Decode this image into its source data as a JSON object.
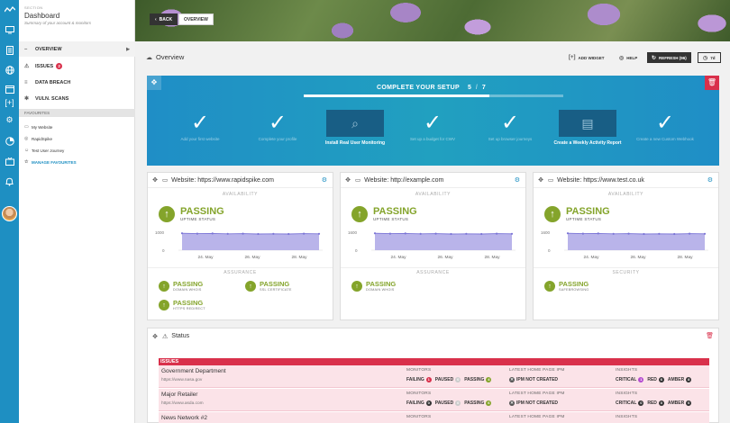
{
  "sidebar": {
    "section_label": "SECTION",
    "title": "Dashboard",
    "subtitle": "Summary of your account & monitors",
    "nav": [
      {
        "label": "OVERVIEW"
      },
      {
        "label": "ISSUES",
        "badge": "2"
      },
      {
        "label": "DATA BREACH"
      },
      {
        "label": "VULN. SCANS"
      }
    ],
    "favourites_label": "FAVOURITES",
    "favourites": [
      "My Website",
      "RapidSpike",
      "Test User Journey"
    ],
    "manage_label": "MANAGE FAVOURITES"
  },
  "header": {
    "back_label": "BACK",
    "overview_label": "OVERVIEW"
  },
  "toolbar": {
    "page_title": "Overview",
    "add_widget": "ADD WIDGET",
    "help": "HELP",
    "refresh": "REFRESH (96)",
    "period": "7d"
  },
  "setup": {
    "title": "COMPLETE YOUR SETUP",
    "done": "5",
    "total": "7",
    "progress": 0.714,
    "steps": [
      {
        "label": "Add your first website",
        "done": true,
        "icon": "checkmark-icon"
      },
      {
        "label": "Complete your profile",
        "done": true,
        "icon": "checkmark-icon"
      },
      {
        "label": "Install Real User Monitoring",
        "done": false,
        "icon": "magnifier-icon"
      },
      {
        "label": "Set up a budget for CWV",
        "done": true,
        "icon": "checkmark-icon"
      },
      {
        "label": "Set up browser journeys",
        "done": true,
        "icon": "checkmark-icon"
      },
      {
        "label": "Create a Weekly Activity Report",
        "done": false,
        "icon": "report-icon"
      },
      {
        "label": "Create a new Custom Webhook",
        "done": true,
        "icon": "checkmark-icon"
      }
    ]
  },
  "cards": [
    {
      "title": "Website: https://www.rapidspike.com",
      "availability_label": "AVAILABILITY",
      "status": "PASSING",
      "status_sub": "UPTIME STATUS",
      "y_max": "1000",
      "y_min": "0",
      "x_labels": [
        "24. May",
        "26. May",
        "28. May"
      ],
      "section2_label": "ASSURANCE",
      "checks": [
        {
          "title": "PASSING",
          "sub": "DOMAIN WHOIS"
        },
        {
          "title": "PASSING",
          "sub": "SSL CERTIFICATE"
        },
        {
          "title": "PASSING",
          "sub": "HTTPS REDIRECT"
        }
      ]
    },
    {
      "title": "Website: http://example.com",
      "availability_label": "AVAILABILITY",
      "status": "PASSING",
      "status_sub": "UPTIME STATUS",
      "y_max": "1600",
      "y_min": "0",
      "x_labels": [
        "24. May",
        "26. May",
        "28. May"
      ],
      "section2_label": "ASSURANCE",
      "checks": [
        {
          "title": "PASSING",
          "sub": "DOMAIN WHOIS"
        }
      ]
    },
    {
      "title": "Website: https://www.test.co.uk",
      "availability_label": "AVAILABILITY",
      "status": "PASSING",
      "status_sub": "UPTIME STATUS",
      "y_max": "1600",
      "y_min": "0",
      "x_labels": [
        "24. May",
        "26. May",
        "28. May"
      ],
      "section2_label": "SECURITY",
      "checks": [
        {
          "title": "PASSING",
          "sub": "SAFEBROWSING"
        }
      ]
    }
  ],
  "status_panel": {
    "title": "Status",
    "issues_label": "ISSUES",
    "col_monitors": "MONITORS",
    "col_ipm": "LATEST HOME PAGE IPM",
    "col_insights": "INSIGHTS",
    "rows": [
      {
        "name": "Government Department",
        "url": "https://www.nasa.gov",
        "failing": "1",
        "paused": "0",
        "passing": "4",
        "ipm": "IPM NOT CREATED",
        "critical": "1",
        "red": "6",
        "amber": "8"
      },
      {
        "name": "Major Retailer",
        "url": "https://www.asda.com",
        "failing": "0",
        "paused": "0",
        "passing": "6",
        "ipm": "IPM NOT CREATED",
        "critical": "0",
        "red": "0",
        "amber": "0"
      },
      {
        "name": "News Network #2",
        "url": "",
        "failing": "",
        "paused": "",
        "passing": "",
        "ipm": "",
        "critical": "",
        "red": "",
        "amber": ""
      }
    ],
    "labels": {
      "failing": "FAILING",
      "paused": "PAUSED",
      "passing": "PASSING",
      "critical": "CRITICAL",
      "red": "RED",
      "amber": "AMBER"
    }
  },
  "colors": {
    "brand": "#1e8fc2",
    "passing": "#84a42b",
    "danger": "#d9304b",
    "series": "#7a74d6"
  }
}
